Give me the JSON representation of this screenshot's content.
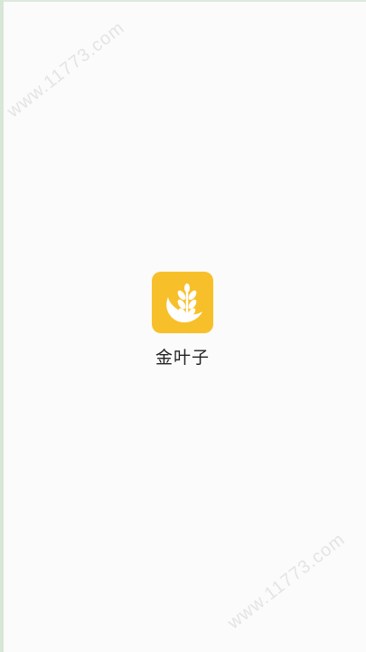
{
  "app": {
    "name": "金叶子",
    "icon": "wheat-leaf-icon",
    "icon_color": "#f7c02b",
    "icon_glyph_color": "#ffffff"
  },
  "watermark": {
    "text": "www.11773.com"
  },
  "colors": {
    "background": "#fbfbfb",
    "edge": "#d7e6d6"
  }
}
